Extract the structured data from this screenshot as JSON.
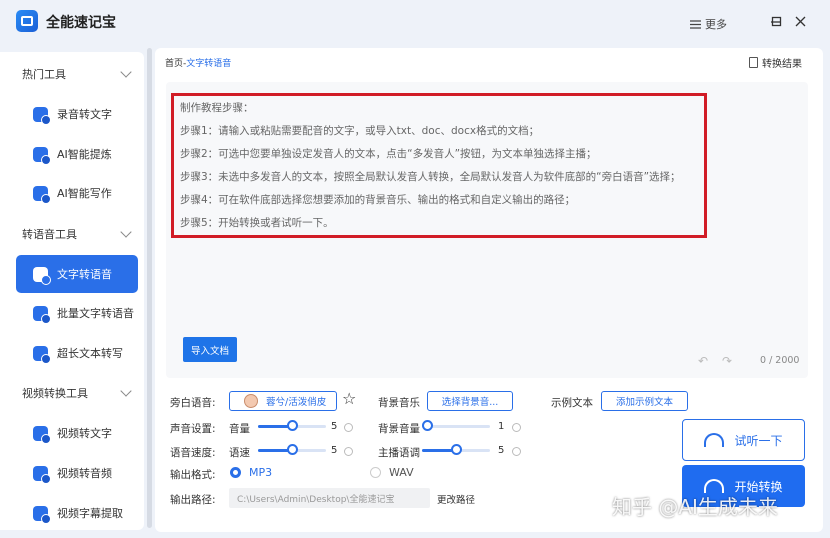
{
  "app": {
    "title": "全能速记宝",
    "more_label": "更多",
    "more_icon": "menu-icon"
  },
  "sidebar": {
    "groups": [
      {
        "label": "热门工具",
        "items": [
          "录音转文字",
          "AI智能提炼",
          "AI智能写作"
        ]
      },
      {
        "label": "转语音工具",
        "items": [
          "文字转语音",
          "批量文字转语音",
          "超长文本转写"
        ]
      },
      {
        "label": "视频转换工具",
        "items": [
          "视频转文字",
          "视频转音频",
          "视频字幕提取"
        ]
      }
    ],
    "active": "文字转语音"
  },
  "breadcrumb": {
    "home": "首页",
    "sep": "-",
    "current": "文字转语音"
  },
  "result_label": "转换结果",
  "editor": {
    "tutorial": [
      "制作教程步骤：",
      "步骤1：请输入或粘贴需要配音的文字，或导入txt、doc、docx格式的文档；",
      "步骤2：可选中您要单独设定发音人的文本，点击“多发音人”按钮，为文本单独选择主播；",
      "步骤3：未选中多发音人的文本，按照全局默认发音人转换，全局默认发音人为软件底部的“旁白语音”选择；",
      "步骤4：可在软件底部选择您想要添加的背景音乐、输出的格式和自定义输出的路径；",
      "步骤5：开始转换或者试听一下。"
    ],
    "import_label": "导入文档",
    "char_count": "0 / 2000"
  },
  "settings": {
    "narration_label": "旁白语音:",
    "voice_name": "蓉兮/活泼俏皮",
    "bgm_label": "背景音乐",
    "bgm_button": "选择背景音...",
    "sample_label": "示例文本",
    "sample_button": "添加示例文本",
    "sound_label": "声音设置:",
    "volume_label": "音量",
    "volume_value": "5",
    "volume_fraction": 0.5,
    "bg_volume_label": "背景音量",
    "bg_volume_value": "1",
    "bg_volume_fraction": 0.0,
    "speed_label": "语音速度:",
    "speed_sub_label": "语速",
    "speed_value": "5",
    "speed_fraction": 0.5,
    "pitch_label": "主播语调",
    "pitch_value": "5",
    "pitch_fraction": 0.5,
    "format_label": "输出格式:",
    "formats": [
      "MP3",
      "WAV"
    ],
    "selected_format": "MP3",
    "path_label": "输出路径:",
    "path_value": "C:\\Users\\Admin\\Desktop\\全能速记宝",
    "change_path": "更改路径"
  },
  "actions": {
    "listen": "试听一下",
    "start": "开始转换"
  },
  "watermark": "知乎 @AI生成未来",
  "colors": {
    "accent": "#2a6fe8",
    "highlight_border": "#d11c26"
  }
}
